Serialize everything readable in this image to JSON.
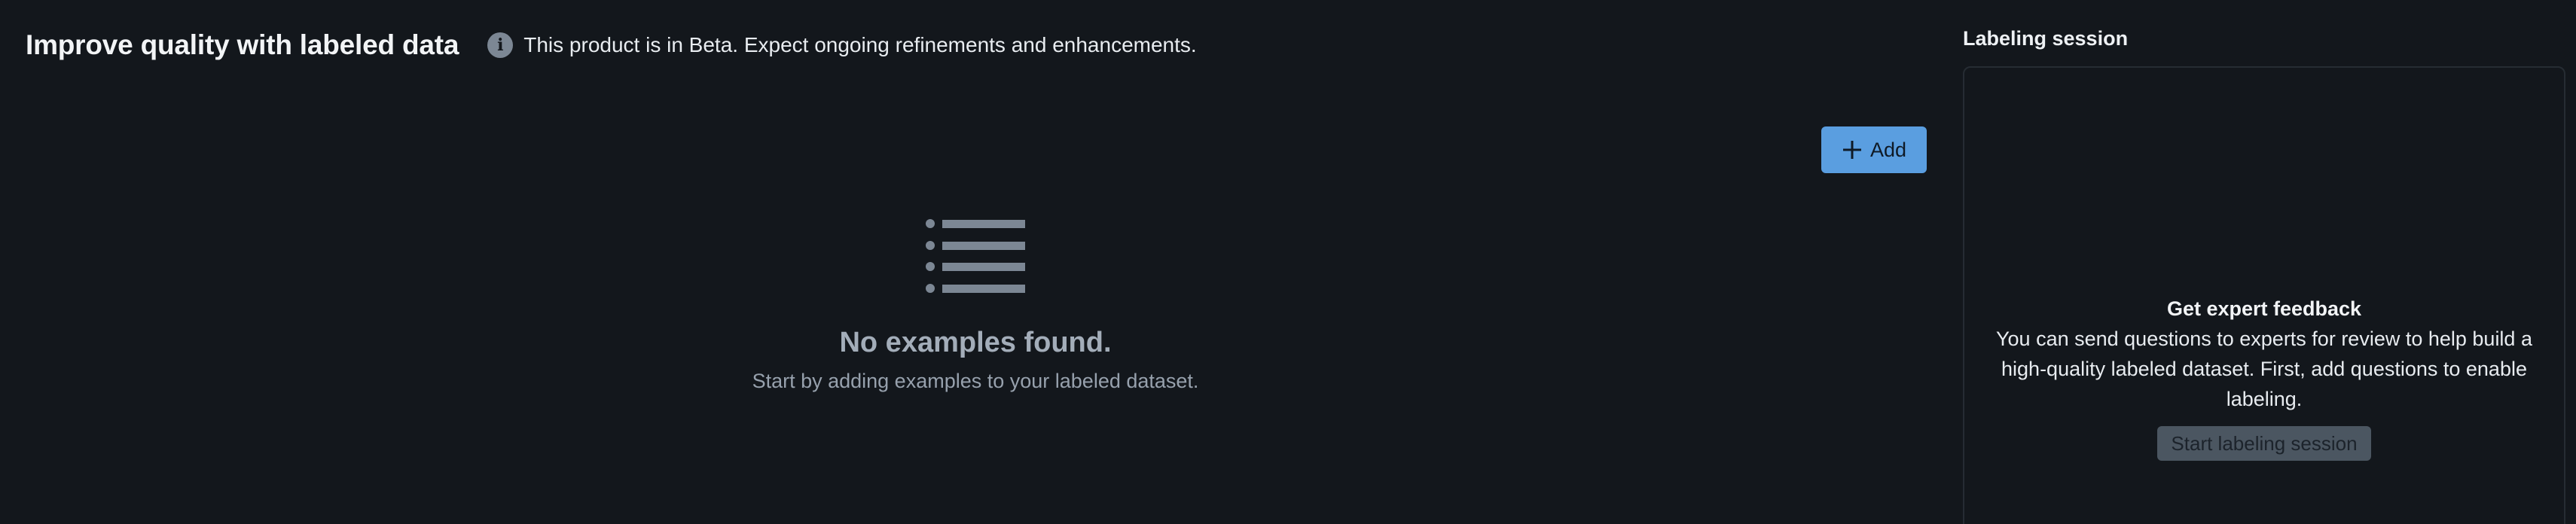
{
  "header": {
    "title": "Improve quality with labeled data",
    "beta_notice": "This product is in Beta. Expect ongoing refinements and enhancements."
  },
  "toolbar": {
    "add_label": "Add"
  },
  "empty_state": {
    "title": "No examples found.",
    "subtitle": "Start by adding examples to your labeled dataset."
  },
  "side_panel": {
    "title": "Labeling session",
    "feedback_title": "Get expert feedback",
    "feedback_description": "You can send questions to experts for review to help build a high-quality labeled dataset. First, add questions to enable labeling.",
    "start_button_label": "Start labeling session"
  },
  "icons": {
    "info": "info-icon",
    "add": "plus-icon",
    "empty": "list-icon"
  },
  "colors": {
    "background": "#13171c",
    "accent": "#5a9ee0",
    "disabled_button": "#4b5661",
    "muted_text": "#a3adb9"
  }
}
